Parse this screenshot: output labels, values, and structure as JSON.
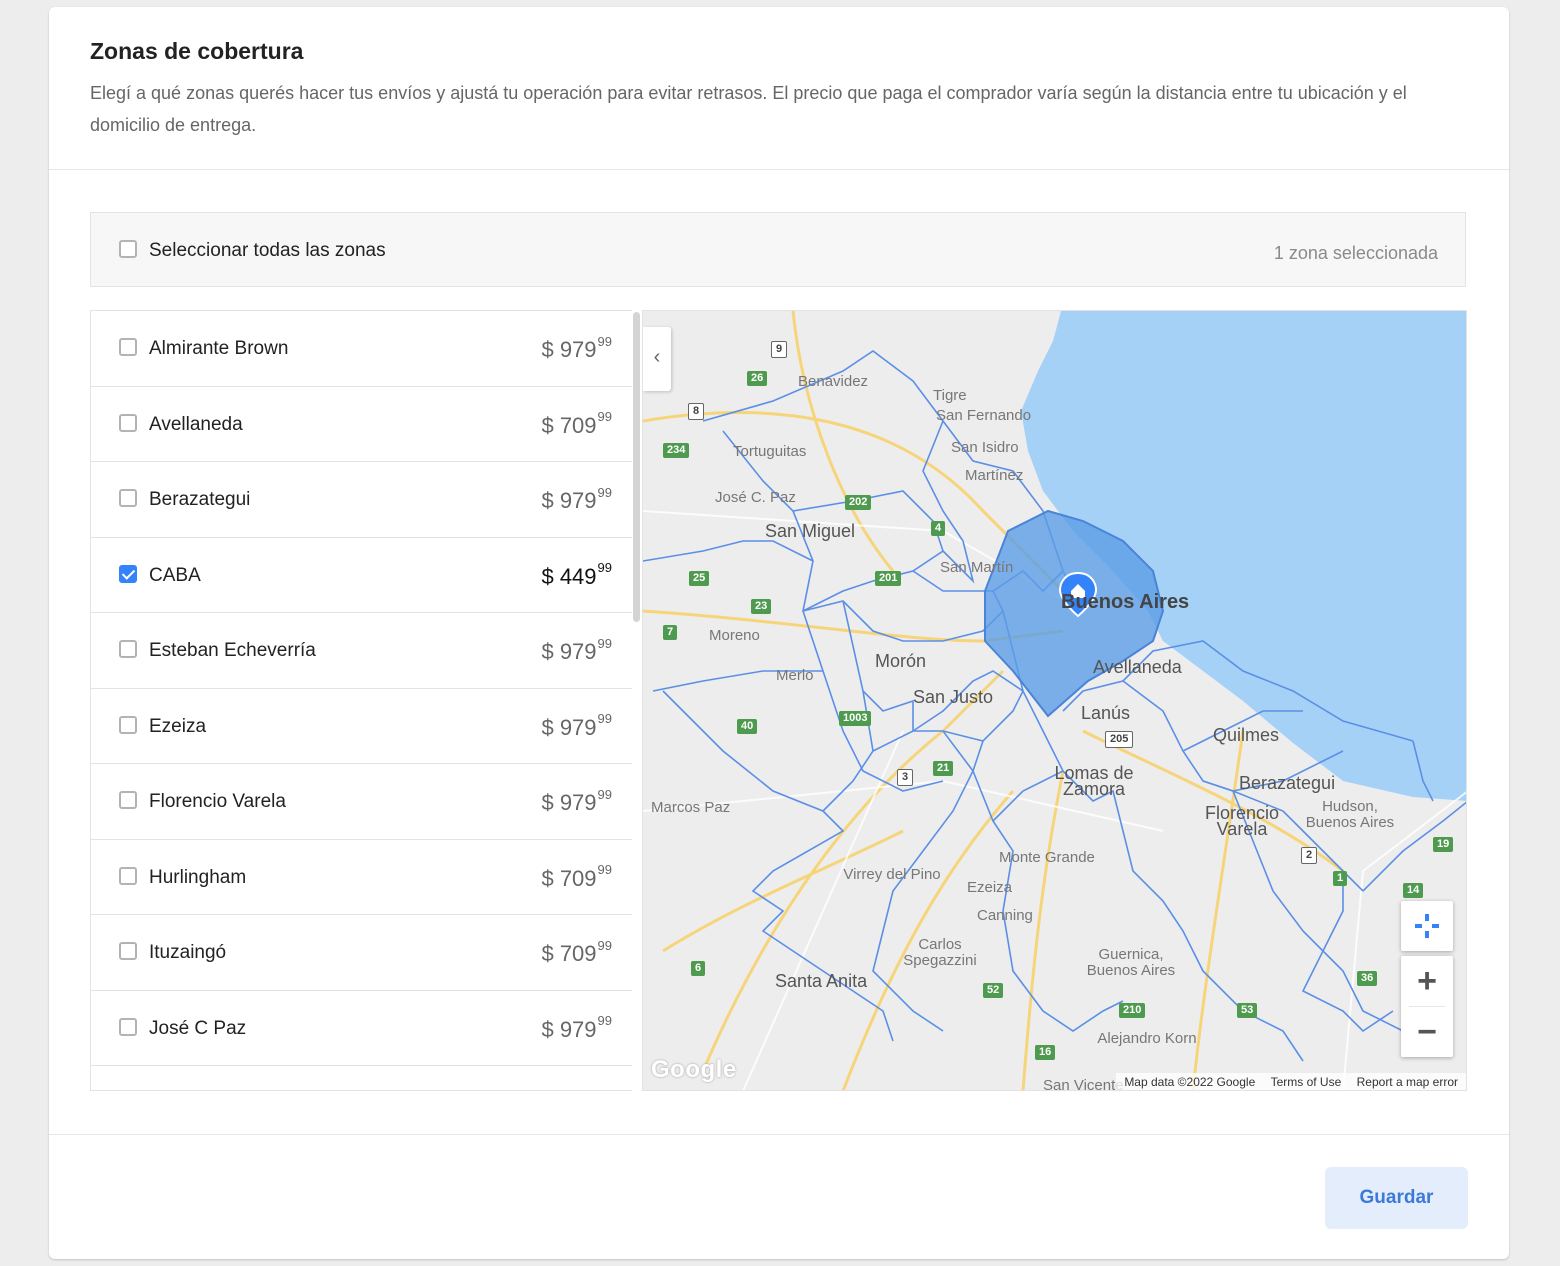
{
  "header": {
    "title": "Zonas de cobertura",
    "description": "Elegí a qué zonas querés hacer tus envíos y ajustá tu operación para evitar retrasos. El precio que paga el comprador varía según la distancia entre tu ubicación y el domicilio de entrega."
  },
  "select_all": {
    "label": "Seleccionar todas las zonas",
    "checked": false,
    "selected_count": "1 zona seleccionada"
  },
  "zones": [
    {
      "name": "Almirante Brown",
      "price_currency": "$",
      "price_int": "979",
      "price_cents": "99",
      "checked": false
    },
    {
      "name": "Avellaneda",
      "price_currency": "$",
      "price_int": "709",
      "price_cents": "99",
      "checked": false
    },
    {
      "name": "Berazategui",
      "price_currency": "$",
      "price_int": "979",
      "price_cents": "99",
      "checked": false
    },
    {
      "name": "CABA",
      "price_currency": "$",
      "price_int": "449",
      "price_cents": "99",
      "checked": true
    },
    {
      "name": "Esteban Echeverría",
      "price_currency": "$",
      "price_int": "979",
      "price_cents": "99",
      "checked": false
    },
    {
      "name": "Ezeiza",
      "price_currency": "$",
      "price_int": "979",
      "price_cents": "99",
      "checked": false
    },
    {
      "name": "Florencio Varela",
      "price_currency": "$",
      "price_int": "979",
      "price_cents": "99",
      "checked": false
    },
    {
      "name": "Hurlingham",
      "price_currency": "$",
      "price_int": "709",
      "price_cents": "99",
      "checked": false
    },
    {
      "name": "Ituzaingó",
      "price_currency": "$",
      "price_int": "709",
      "price_cents": "99",
      "checked": false
    },
    {
      "name": "José C Paz",
      "price_currency": "$",
      "price_int": "979",
      "price_cents": "99",
      "checked": false
    }
  ],
  "map": {
    "collapse_icon": "chevron-left-icon",
    "place_labels": [
      "Benavidez",
      "Tigre",
      "San Fernando",
      "San Isidro",
      "Martínez",
      "Tortuguitas",
      "José C. Paz",
      "San Miguel",
      "San Martín",
      "Buenos Aires",
      "Moreno",
      "Morón",
      "Merlo",
      "San Justo",
      "Avellaneda",
      "Lanús",
      "Quilmes",
      "Lomas de Zamora",
      "Berazategui",
      "Marcos Paz",
      "Florencio Varela",
      "Hudson, Buenos Aires",
      "Monte Grande",
      "Virrey del Pino",
      "Ezeiza",
      "Canning",
      "Carlos Spegazzini",
      "Santa Anita",
      "Guernica, Buenos Aires",
      "Alejandro Korn",
      "San Vicente"
    ],
    "route_shields": [
      "9",
      "26",
      "8",
      "234",
      "202",
      "4",
      "25",
      "201",
      "23",
      "7",
      "1003",
      "40",
      "3",
      "21",
      "205",
      "19",
      "36",
      "14",
      "6",
      "52",
      "210",
      "16",
      "53",
      "2",
      "1"
    ],
    "zoom_in": "+",
    "zoom_out": "−",
    "logo_text": "Google",
    "attribution": {
      "data": "Map data ©2022 Google",
      "terms": "Terms of Use",
      "report": "Report a map error"
    },
    "colors": {
      "water": "#a6d1f7",
      "land": "#ededed",
      "zone_border": "#5b8fe6",
      "selected_zone_fill": "#5b9ee6",
      "road": "#f6d57a"
    }
  },
  "footer": {
    "save_label": "Guardar"
  },
  "colors": {
    "accent": "#3483fa",
    "save_button_bg": "#e3edfb",
    "save_button_text": "#3d7ad8"
  }
}
